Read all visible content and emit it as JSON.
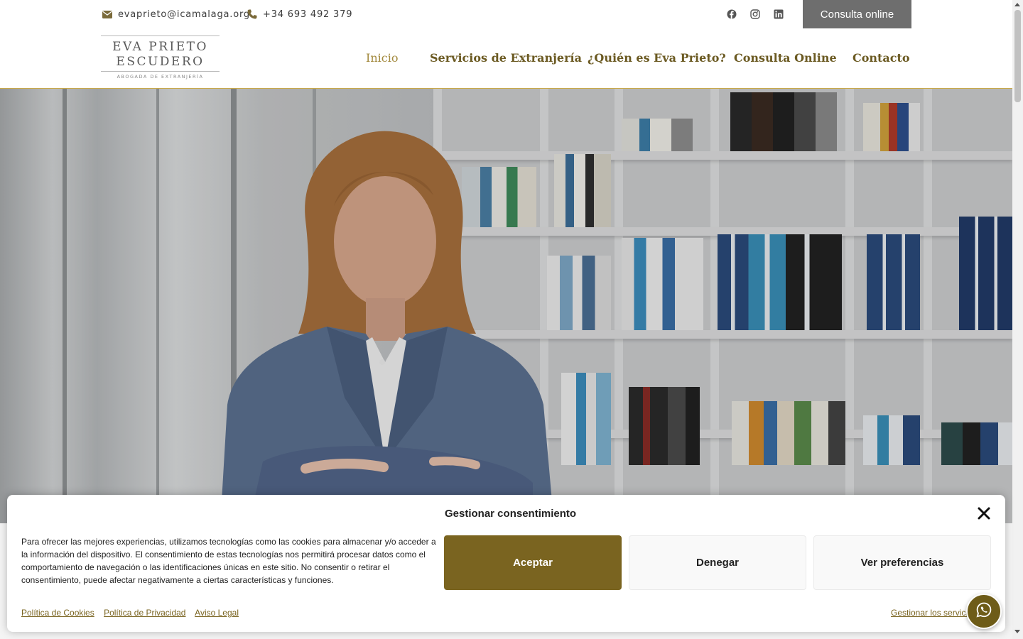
{
  "topbar": {
    "email": "evaprieto@icamalaga.org",
    "phone": "+34 693 492 379",
    "social": [
      "facebook-icon",
      "instagram-icon",
      "linkedin-icon"
    ],
    "cta": "Consulta online"
  },
  "logo": {
    "line1": "EVA PRIETO",
    "line2": "ESCUDERO",
    "tagline": "ABOGADA DE EXTRANJERÍA"
  },
  "nav": {
    "items": [
      {
        "label": "Inicio",
        "active": true
      },
      {
        "label": "Servicios de Extranjería",
        "active": false
      },
      {
        "label": "¿Quién es Eva Prieto?",
        "active": false
      },
      {
        "label": "Consulta Online",
        "active": false
      },
      {
        "label": "Contacto",
        "active": false
      }
    ]
  },
  "cookie": {
    "title": "Gestionar consentimiento",
    "message": "Para ofrecer las mejores experiencias, utilizamos tecnologías como las cookies para almacenar y/o acceder a la información del dispositivo. El consentimiento de estas tecnologías nos permitirá procesar datos como el comportamiento de navegación o las identificaciones únicas en este sitio. No consentir o retirar el consentimiento, puede afectar negativamente a ciertas características y funciones.",
    "accept": "Aceptar",
    "deny": "Denegar",
    "preferences": "Ver preferencias",
    "links": [
      "Política de Cookies",
      "Política de Privacidad",
      "Aviso Legal"
    ],
    "manage": "Gestionar los servicios"
  },
  "colors": {
    "accent": "#7a6420",
    "nav_text": "#6b5a22",
    "nav_active": "#a38a3e",
    "cta_bg": "#6e6e6e"
  }
}
